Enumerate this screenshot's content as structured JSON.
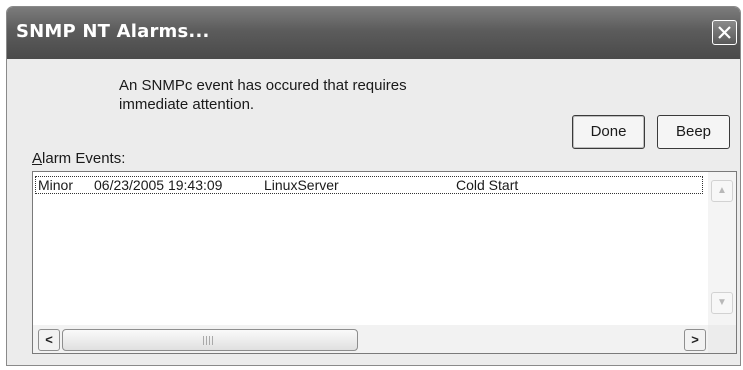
{
  "window": {
    "title": "SNMP NT Alarms...",
    "close_label": "Close"
  },
  "message": {
    "line1": "An SNMPc event has occured that requires",
    "line2": "immediate attention."
  },
  "buttons": {
    "done_label": "Done",
    "beep_label": "Beep"
  },
  "alarm_events": {
    "label_mnemonic": "A",
    "label_rest": "larm Events:",
    "rows": [
      {
        "severity": "Minor",
        "timestamp": "06/23/2005 19:43:09",
        "host": "LinuxServer",
        "description": "Cold Start"
      }
    ],
    "horizontal_scroll_fraction": 0.0
  },
  "icons": {
    "close": "close-x-icon",
    "scroll_up": "arrow-up-icon",
    "scroll_down": "arrow-down-icon",
    "scroll_left": "arrow-left-icon",
    "scroll_right": "arrow-right-icon"
  },
  "colors": {
    "title_bar": "#5c5c5c",
    "title_text": "#ffffff",
    "dialog_background": "#ececec"
  }
}
